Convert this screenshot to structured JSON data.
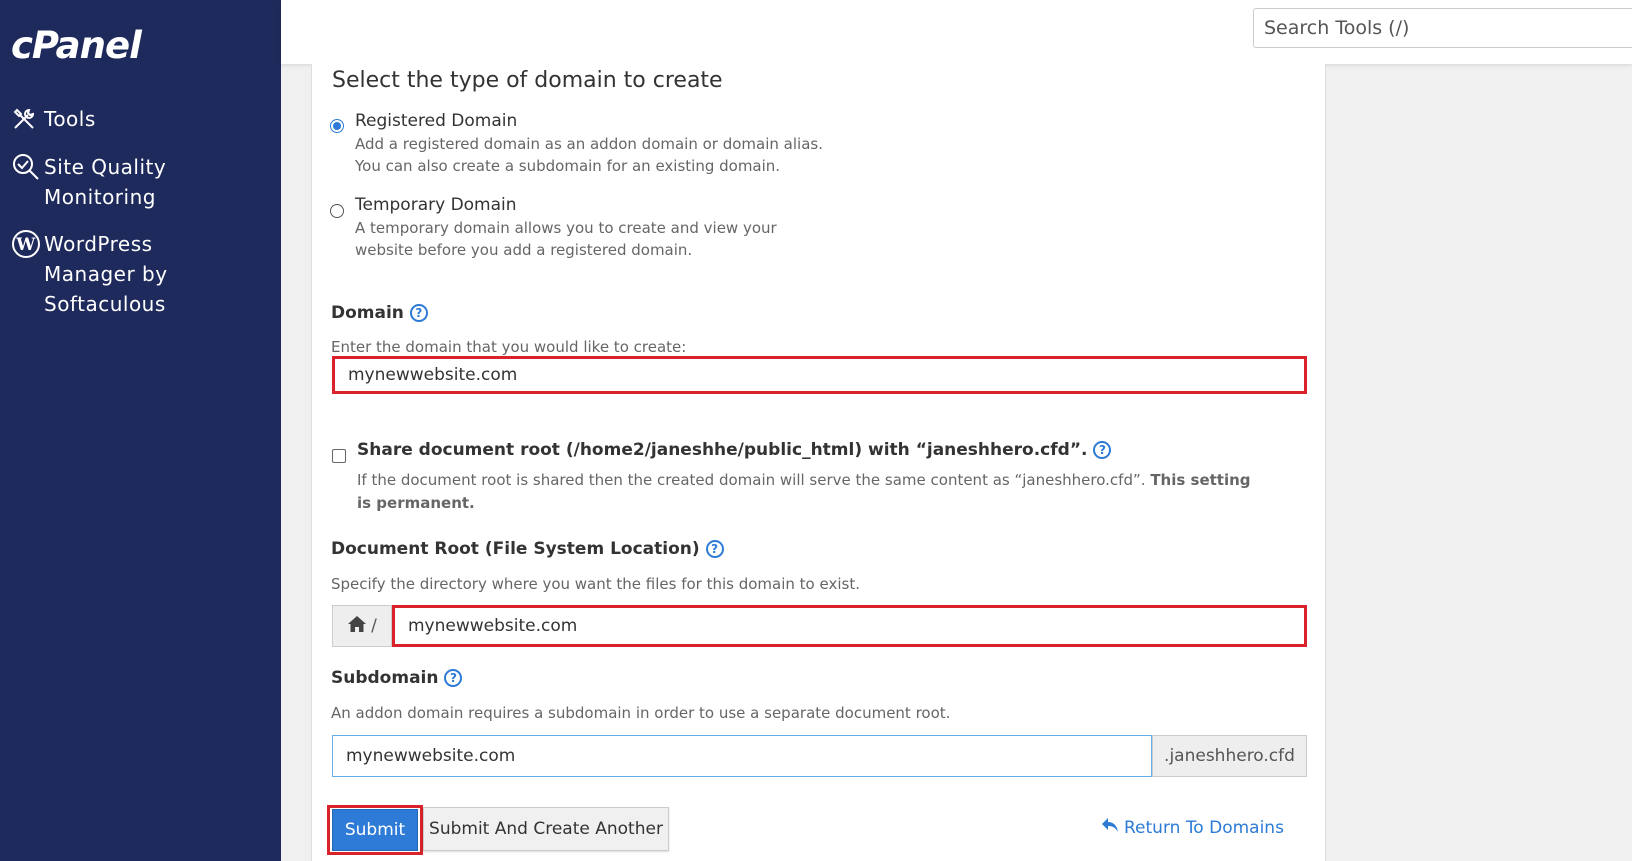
{
  "sidebar": {
    "logo": "cPanel",
    "items": [
      {
        "label": "Tools",
        "icon": "tools-icon"
      },
      {
        "label": "Site Quality Monitoring",
        "icon": "site-quality-icon"
      },
      {
        "label": "WordPress Manager by Softaculous",
        "icon": "wordpress-icon"
      }
    ]
  },
  "header": {
    "search_placeholder": "Search Tools (/)"
  },
  "form": {
    "title": "Select the type of domain to create",
    "registered": {
      "label": "Registered Domain",
      "desc_line1": "Add a registered domain as an addon domain or domain alias.",
      "desc_line2": "You can also create a subdomain for an existing domain.",
      "checked": true
    },
    "temporary": {
      "label": "Temporary Domain",
      "desc_line1": "A temporary domain allows you to create and view your",
      "desc_line2": "website before you add a registered domain.",
      "checked": false
    },
    "domain": {
      "label": "Domain",
      "hint": "Enter the domain that you would like to create:",
      "value": "mynewwebsite.com"
    },
    "share": {
      "label": "Share document root (/home2/janeshhe/public_html) with “janeshhero.cfd”.",
      "desc": "If the document root is shared then the created domain will serve the same content as “janeshhero.cfd”.",
      "desc_bold": "This setting is permanent.",
      "checked": false
    },
    "docroot": {
      "label": "Document Root (File System Location)",
      "hint": "Specify the directory where you want the files for this domain to exist.",
      "prefix": "/",
      "value": "mynewwebsite.com"
    },
    "subdomain": {
      "label": "Subdomain",
      "hint": "An addon domain requires a subdomain in order to use a separate document root.",
      "value": "mynewwebsite.com",
      "suffix": ".janeshhero.cfd"
    },
    "buttons": {
      "submit": "Submit",
      "submit_another": "Submit And Create Another",
      "return": "Return To Domains"
    }
  },
  "colors": {
    "sidebar_bg": "#1f2a5c",
    "accent": "#2d7bd6",
    "highlight": "#d9222a"
  }
}
